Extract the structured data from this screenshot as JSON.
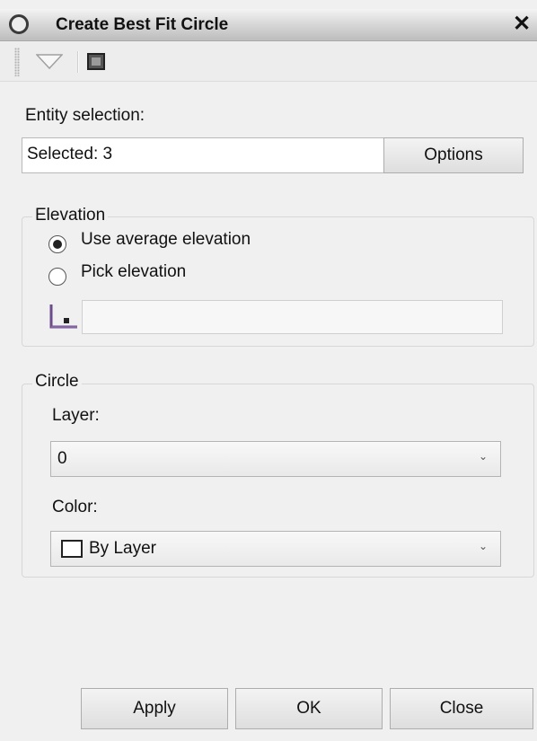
{
  "window": {
    "title": "Create Best Fit Circle",
    "close_glyph": "✕"
  },
  "toolbar": {
    "items": [
      {
        "name": "grip-handle-icon"
      },
      {
        "name": "dropdown-triangle-icon"
      },
      {
        "name": "command-window-icon"
      }
    ]
  },
  "entity_selection": {
    "label": "Entity selection:",
    "value": "Selected: 3",
    "options_button": "Options"
  },
  "elevation": {
    "legend": "Elevation",
    "options": [
      {
        "label": "Use average elevation",
        "checked": true
      },
      {
        "label": "Pick elevation",
        "checked": false
      }
    ],
    "pick_value": ""
  },
  "circle": {
    "legend": "Circle",
    "layer_label": "Layer:",
    "layer_value": "0",
    "color_label": "Color:",
    "color_value": "By Layer",
    "color_swatch": "#ffffff"
  },
  "footer": {
    "apply": "Apply",
    "ok": "OK",
    "close": "Close"
  }
}
